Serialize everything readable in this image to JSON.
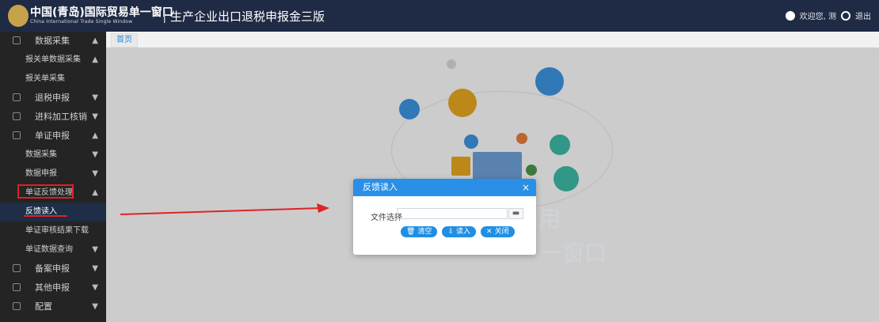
{
  "header": {
    "logo_cn": "中国(青岛)国际贸易单一窗口",
    "logo_en": "China International Trade Single Window",
    "separator": "|",
    "title": "生产企业出口退税申报金三版",
    "welcome_text": "欢迎您, 测",
    "logout_label": "退出"
  },
  "tabs": [
    {
      "label": "首页"
    }
  ],
  "sidebar": {
    "items": [
      {
        "label": "数据采集",
        "caret": "▲",
        "type": "top"
      },
      {
        "label": "报关单数据采集",
        "caret": "▲",
        "type": "sub"
      },
      {
        "label": "报关单采集",
        "caret": "",
        "type": "sub"
      },
      {
        "label": "退税申报",
        "caret": "▼",
        "type": "top"
      },
      {
        "label": "进料加工核销",
        "caret": "▼",
        "type": "top"
      },
      {
        "label": "单证申报",
        "caret": "▲",
        "type": "top"
      },
      {
        "label": "数据采集",
        "caret": "▼",
        "type": "sub"
      },
      {
        "label": "数据申报",
        "caret": "▼",
        "type": "sub"
      },
      {
        "label": "单证反馈处理",
        "caret": "▲",
        "type": "sub"
      },
      {
        "label": "反馈读入",
        "caret": "",
        "type": "sub"
      },
      {
        "label": "单证审核结果下载",
        "caret": "",
        "type": "sub"
      },
      {
        "label": "单证数据查询",
        "caret": "▼",
        "type": "sub"
      },
      {
        "label": "备案申报",
        "caret": "▼",
        "type": "top"
      },
      {
        "label": "其他申报",
        "caret": "▼",
        "type": "top"
      },
      {
        "label": "配置",
        "caret": "▼",
        "type": "top"
      }
    ]
  },
  "background_text": {
    "part1": "用",
    "part2": "一窗口"
  },
  "modal": {
    "title": "反馈读入",
    "close": "×",
    "field_label": "文件选择",
    "field_value": "",
    "field_button": "▬",
    "buttons": [
      {
        "label": "清空",
        "icon": "🗑"
      },
      {
        "label": "读入",
        "icon": "⇩"
      },
      {
        "label": "关闭",
        "icon": "✕"
      }
    ]
  },
  "colors": {
    "topbar": "#1f2a44",
    "sidebar": "#242424",
    "accent": "#2a8fe6",
    "highlight": "#d22222"
  }
}
